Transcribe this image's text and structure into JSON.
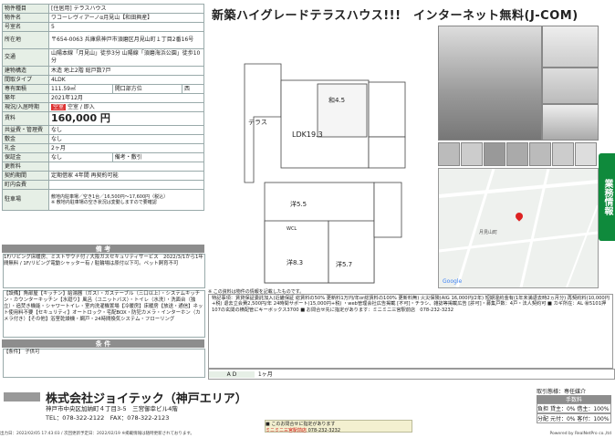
{
  "spec": {
    "rows": [
      {
        "k": "物件種目",
        "v": "[住居用] テラスハウス"
      },
      {
        "k": "物件名",
        "v": "ワコーレヴィアーノα月見山【和田興産】"
      },
      {
        "k": "号室名",
        "v": "5"
      },
      {
        "k": "所在地",
        "v": "〒654-0063 兵庫県神戸市須磨区月見山町１丁目2番16号"
      },
      {
        "k": "交通",
        "v": "山陽本線「月見山」徒歩3分 山陽線「須磨海浜公園」徒歩10分"
      },
      {
        "k": "建物構造",
        "v": "木造 地上2階 総戸数7戸"
      },
      {
        "k": "間取タイプ",
        "v": "4LDK"
      },
      {
        "k": "専有面積",
        "v": "111.59㎡"
      },
      {
        "k": "築年",
        "v": "2021年12月"
      },
      {
        "k": "現況/入居時期",
        "v": "空室 / 即入"
      },
      {
        "k": "賃料",
        "v": "160,000 円"
      },
      {
        "k": "共益費・管理費",
        "v": "なし"
      },
      {
        "k": "敷金",
        "v": "なし"
      },
      {
        "k": "礼金",
        "v": "2ヶ月"
      },
      {
        "k": "保証金",
        "v": "なし"
      },
      {
        "k": "更新料",
        "v": ""
      },
      {
        "k": "契約期間",
        "v": "定期借家 4年間 再契約可能"
      },
      {
        "k": "町内会費",
        "v": ""
      },
      {
        "k": "駐車場",
        "v": "敷地内駐車場／空き1台／16,500円～17,600円（税込）"
      }
    ],
    "extra": {
      "opening_label": "開口部方位",
      "opening_value": "西",
      "deposit_label": "備考・敷引",
      "vacant_badge": "空室",
      "parking_note": "※ 敷地内駐車場の空き状況は変動しますので要確認"
    }
  },
  "bikou_title": "備 考",
  "bikou_text": "1F/リビング床暖房、ミストサウナ付 / 大阪ガスセキュリティサービス　2022/3/1から1年間無料 / 1F/リビング電動シャッター有 / 駐輪場は原付以下可。ペット飼育不可",
  "setsubi_text": "【設備】角部屋【キッチン】給湯器（ガス）・ガステーブル（三口以上）・システムキッチン・カウンターキッチン【水廻り】風呂（ユニットバス）・トイレ（水洗）・洗面台（独立）・追焚き機能・シャワートイレ・室内洗濯機置場【冷暖房】床暖房【放送・通信】ネット使用料不要【セキュリティ】オートロック・宅配BOX・防犯カメラ・インターホン（カメラ付き）【その他】浴室乾燥機・網戸・24時間換気システム・フローリング",
  "jouken_title": "条 件",
  "jouken_text": "【条件】 子供可",
  "headline": "新築ハイグレードテラスハウス!!!　インターネット無料(J-COM)",
  "badge": "業務情報",
  "floorplan": {
    "terrace": "テラス",
    "ldk": "LDK19.3",
    "washitsu": "和4.5",
    "yo55": "洋5.5",
    "yo83": "洋8.3",
    "yo57": "洋5.7",
    "wcl": "WCL",
    "note": "※ この資料は物件の情報を記載したものです。"
  },
  "map": {
    "label": "月見山町",
    "credit": "Google"
  },
  "notes_text": "特記事項：賃貸保証委託加入(近畿保証 総賃料の50% 更新料1万円/年or総賃料の100% 更新料無) 火災保険(AIG 16,000円/2年) 短期違約金有(1年未満退去時2ヵ月分) 再契約料(10,000円+税) 退去立会費2,500円/年 24時間サポート(15,000円+税) ・web管理会社広告掲載 [不可]・チラシ、雑誌等掲載広告 [許可]・募集戸数：4戸・法人契約可 ■ カギ所在：AL ㊙5101押 107の玄関の横配管にキーボックス3700 ■ お問合せ先に指定があります：ミニミニ三宮駅前店　078-232-3232",
  "ad_label": "A D",
  "ad_value": "1ヶ月",
  "footer": {
    "company": "株式会社ジョイテック（神戸エリア）",
    "address": "神戸市中央区加納町４丁目3-5　三宮御幸ビル4階",
    "tel": "TEL：078-322-2122　FAX：078-322-2123",
    "torihiki_label": "取引態様：専任媒介",
    "fee_title": "手数料",
    "fee_rows": [
      [
        "負担",
        "貸主：0% 借主：100%"
      ],
      [
        "分配",
        "元付：0% 客付：100%"
      ]
    ]
  },
  "contact": {
    "title": "■ このお問合せに指定があります",
    "shop": "ミニミニ三宮駅前店",
    "tel": "078-232-3232"
  },
  "bottom": "出力日：2022/02/05 17:43:03 / 次回更新予定日：2022/02/19 ※掲載情報は随時更新されております。",
  "powered": "Powered by RealNetPro co.,ltd"
}
